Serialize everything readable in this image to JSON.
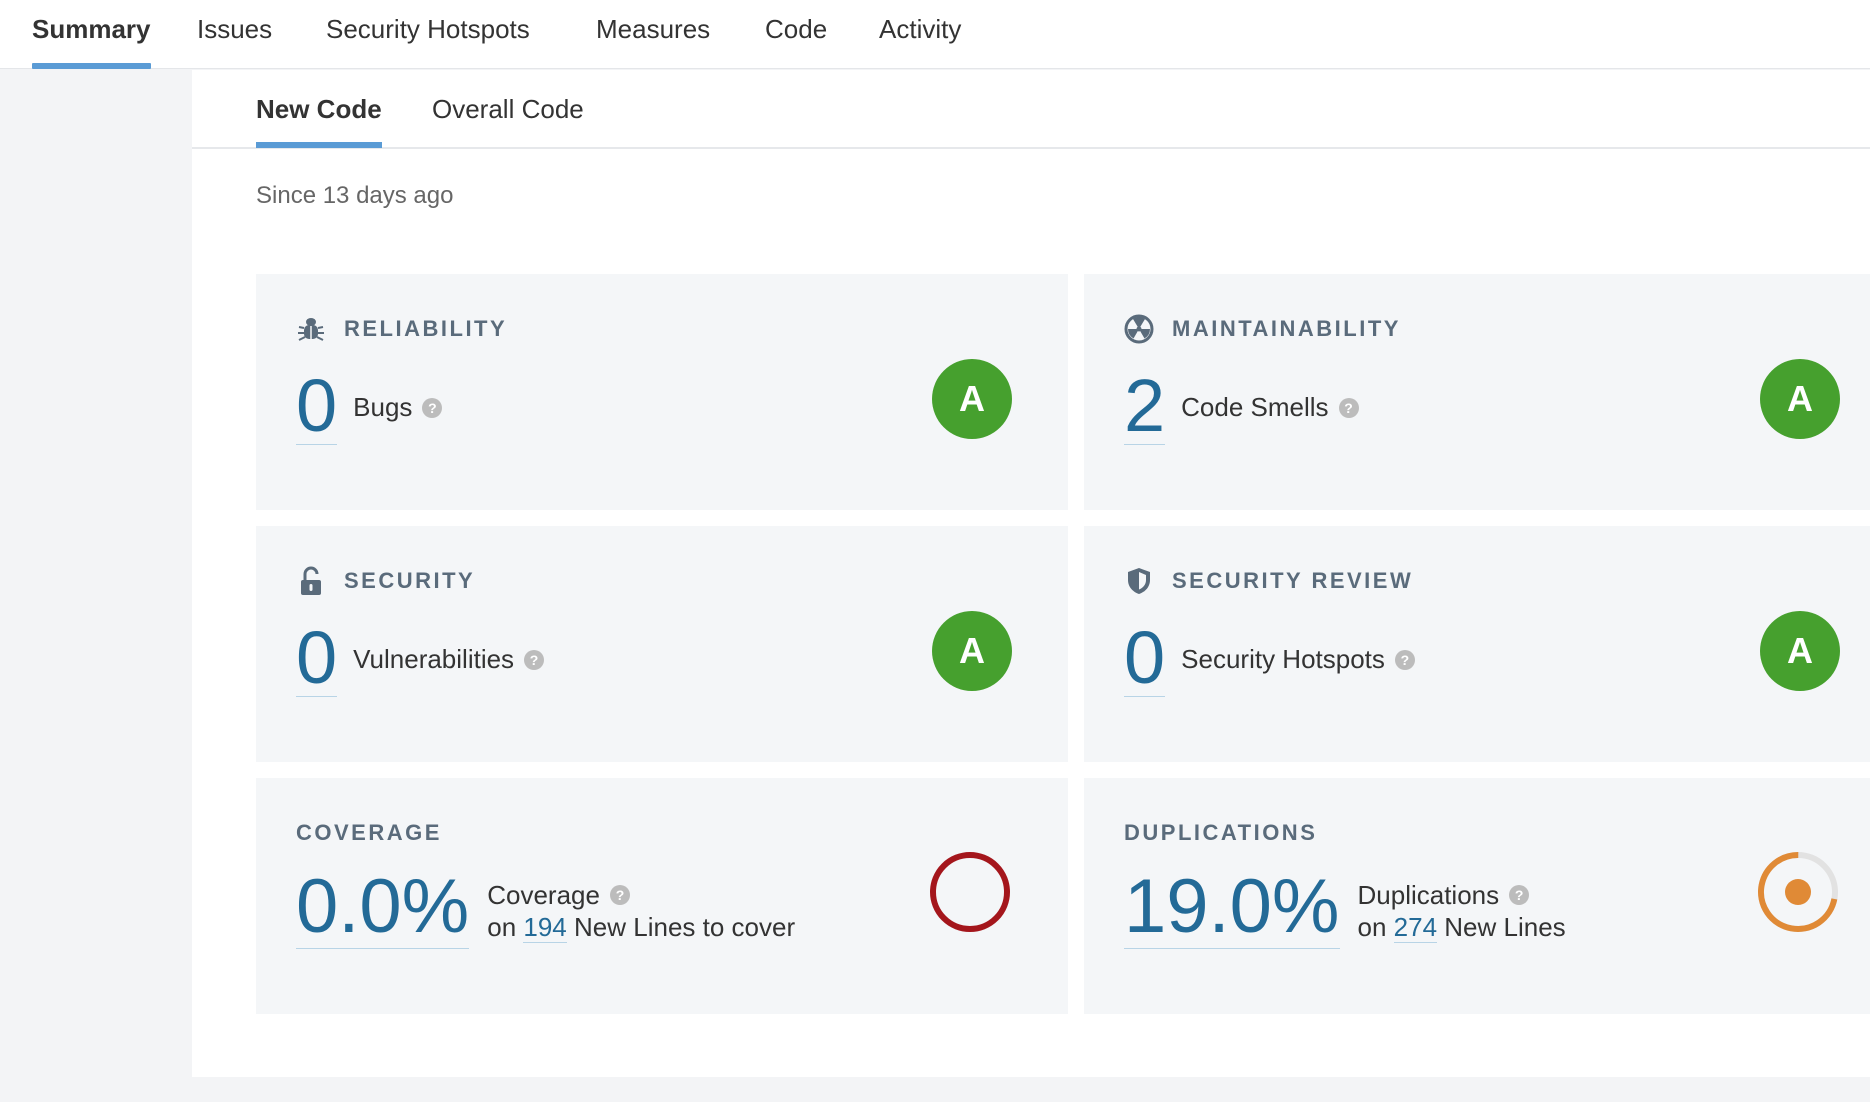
{
  "nav": {
    "tabs": [
      {
        "label": "Summary",
        "active": true
      },
      {
        "label": "Issues"
      },
      {
        "label": "Security Hotspots"
      },
      {
        "label": "Measures"
      },
      {
        "label": "Code"
      },
      {
        "label": "Activity"
      }
    ]
  },
  "subtabs": [
    {
      "label": "New Code",
      "active": true
    },
    {
      "label": "Overall Code"
    }
  ],
  "period": "Since 13 days ago",
  "cards": {
    "reliability": {
      "title": "RELIABILITY",
      "icon": "bug-icon",
      "value": "0",
      "label": "Bugs",
      "rating": "A"
    },
    "maintainability": {
      "title": "MAINTAINABILITY",
      "icon": "radioactive-icon",
      "value": "2",
      "label": "Code Smells",
      "rating": "A"
    },
    "security": {
      "title": "SECURITY",
      "icon": "unlock-icon",
      "value": "0",
      "label": "Vulnerabilities",
      "rating": "A"
    },
    "security_review": {
      "title": "SECURITY REVIEW",
      "icon": "shield-icon",
      "value": "0",
      "label": "Security Hotspots",
      "rating": "A"
    },
    "coverage": {
      "title": "COVERAGE",
      "value": "0.0%",
      "label": "Coverage",
      "on_prefix": "on",
      "lines": "194",
      "lines_suffix": "New Lines to cover",
      "ring_color": "#a4161c",
      "fraction": 0.0
    },
    "duplications": {
      "title": "DUPLICATIONS",
      "value": "19.0%",
      "label": "Duplications",
      "on_prefix": "on",
      "lines": "274",
      "lines_suffix": "New Lines",
      "ring_color": "#e08a36",
      "fraction": 0.19
    }
  },
  "colors": {
    "rating_a": "#46a02e",
    "link": "#236a97",
    "tab_indicator": "#5a9bd5"
  },
  "help_glyph": "?"
}
